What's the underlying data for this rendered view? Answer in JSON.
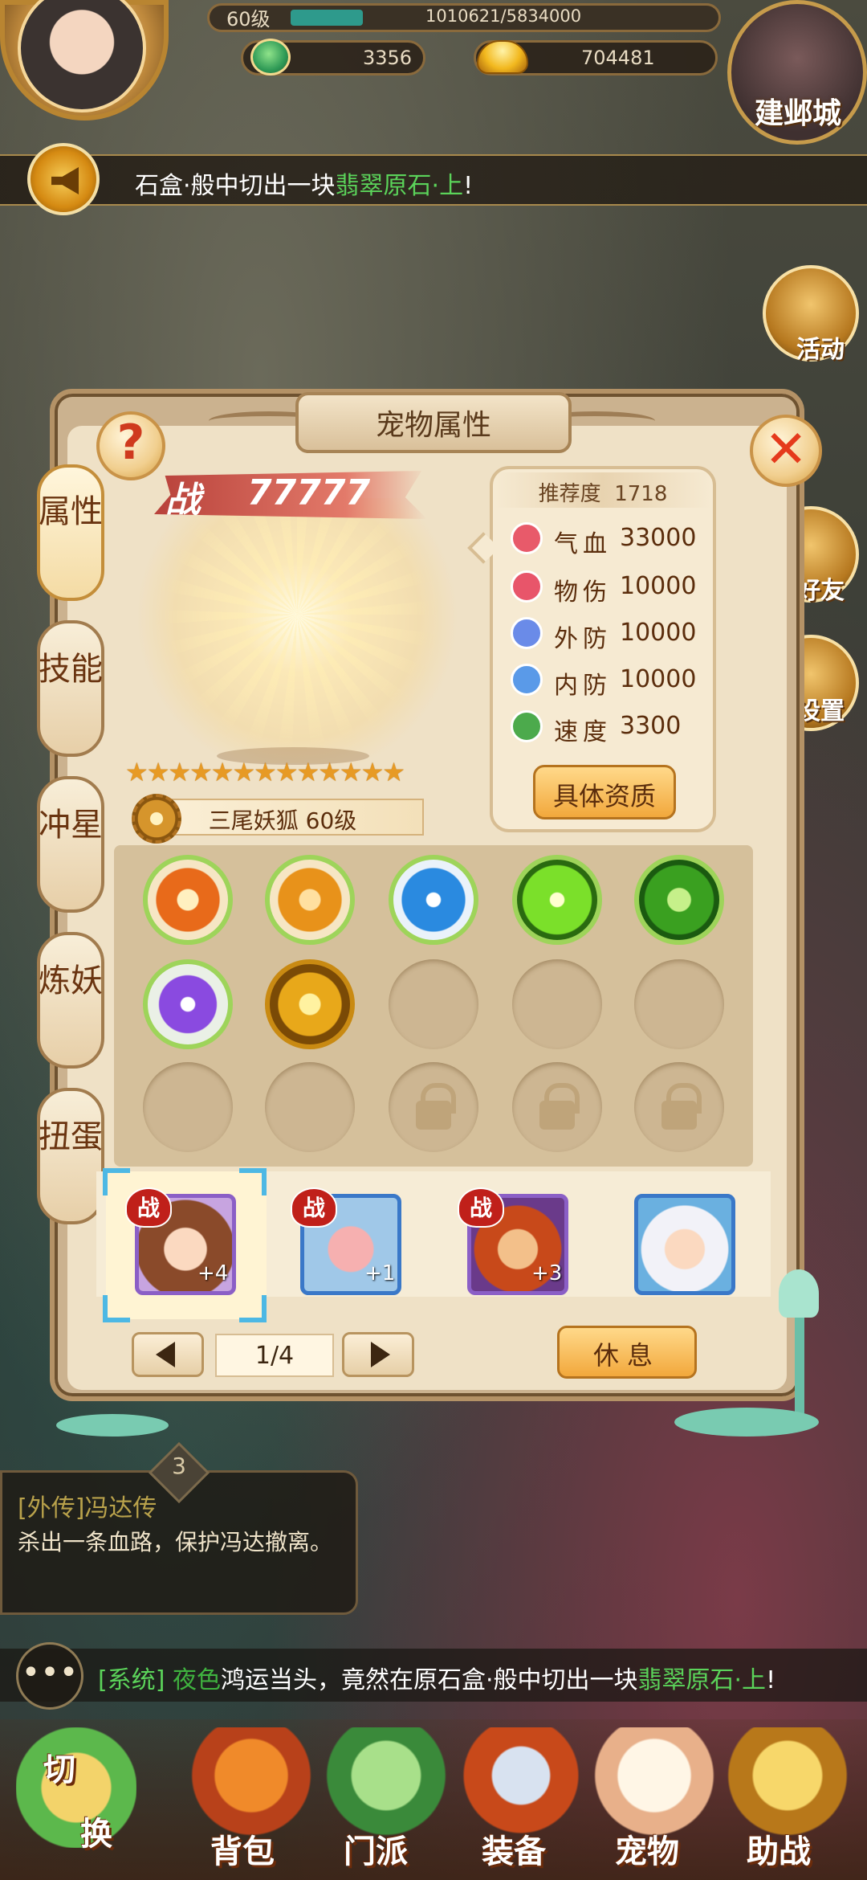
{
  "hud": {
    "level": "60级",
    "exp": "1010621/5834000",
    "exp_fraction": 0.173,
    "jade": "3356",
    "gold": "704481",
    "city_label": "建邺城"
  },
  "marquee": {
    "prefix": "石盒·般中切出一块",
    "highlight": "翡翠原石·上",
    "suffix": "!"
  },
  "side_menu": [
    "活动",
    "好友",
    "设置"
  ],
  "panel": {
    "title": "宠物属性",
    "help_glyph": "?",
    "close_glyph": "✕",
    "tabs": [
      "属性",
      "技能",
      "冲星",
      "炼妖",
      "扭蛋"
    ],
    "active_tab": 0
  },
  "pet": {
    "power_prefix": "战",
    "power": "77777",
    "stars": "★★★★★★★★★★★★★",
    "star_count": 13,
    "name": "三尾妖狐 60级"
  },
  "stats": {
    "recommend_label": "推荐度",
    "recommend": "1718",
    "items": [
      {
        "name": "气血",
        "value": "33000",
        "icon": "heart-icon",
        "color": "#e85a6a"
      },
      {
        "name": "物伤",
        "value": "10000",
        "icon": "sword-icon",
        "color": "#e8556a"
      },
      {
        "name": "外防",
        "value": "10000",
        "icon": "shield-icon",
        "color": "#6a8be8"
      },
      {
        "name": "内防",
        "value": "10000",
        "icon": "swirl-icon",
        "color": "#5a9ae8"
      },
      {
        "name": "速度",
        "value": "3300",
        "icon": "boot-icon",
        "color": "#4caa4c"
      }
    ],
    "detail_button": "具体资质"
  },
  "skills": [
    {
      "icon": "flame-icon",
      "color": "#e86a1a"
    },
    {
      "icon": "mountain-icon",
      "color": "#e8921a"
    },
    {
      "icon": "vortex-icon",
      "color": "#2a8ae0"
    },
    {
      "icon": "burst-icon",
      "color": "#7be02a"
    },
    {
      "icon": "shell-icon",
      "color": "#3aa020"
    },
    {
      "icon": "lightning-icon",
      "color": "#8a4ae0"
    },
    {
      "icon": "golden-heart-icon",
      "color": "#e8a81a"
    }
  ],
  "roster": {
    "badge": "战",
    "pets": [
      {
        "plus": "+4",
        "battle": true,
        "selected": true
      },
      {
        "plus": "+1",
        "battle": true,
        "selected": false
      },
      {
        "plus": "+3",
        "battle": true,
        "selected": false
      },
      {
        "plus": "",
        "battle": false,
        "selected": false
      }
    ],
    "page": "1/4",
    "rest_button": "休息"
  },
  "quest": {
    "number": "3",
    "title": "[外传]冯达传",
    "desc": "杀出一条血路，保护冯达撤离。"
  },
  "chat": {
    "channel": "[系统]",
    "user": "夜色",
    "text1": "鸿运当头，竟然在原石盒·般中切出一块",
    "item": "翡翠原石·上",
    "end": "!"
  },
  "bottom_nav": [
    "切换",
    "背包",
    "门派",
    "装备",
    "宠物",
    "助战"
  ]
}
